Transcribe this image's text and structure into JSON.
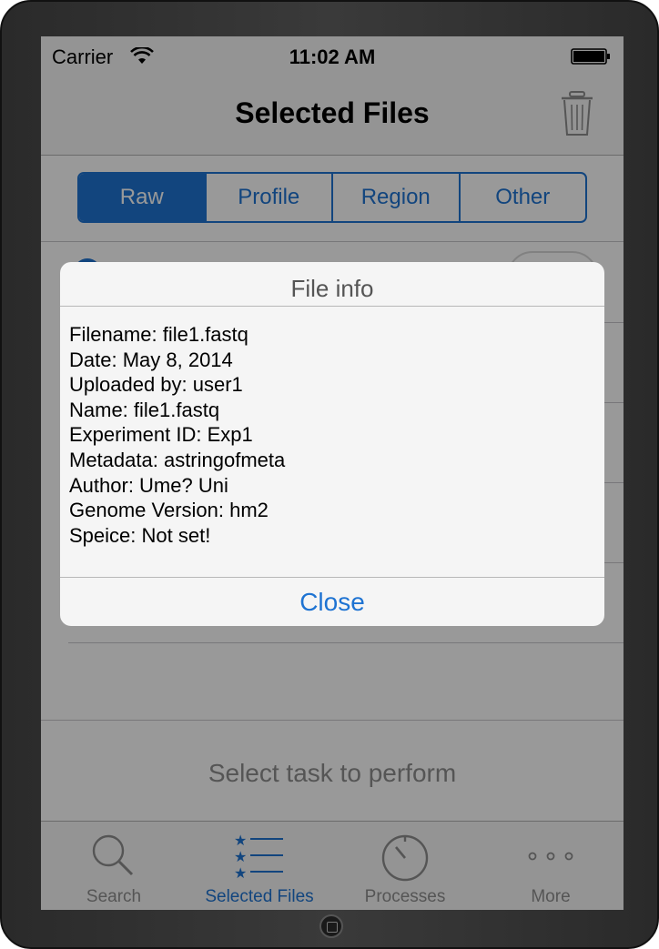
{
  "status_bar": {
    "carrier": "Carrier",
    "time": "11:02 AM"
  },
  "nav": {
    "title": "Selected Files"
  },
  "segments": [
    {
      "label": "Raw",
      "selected": true
    },
    {
      "label": "Profile",
      "selected": false
    },
    {
      "label": "Region",
      "selected": false
    },
    {
      "label": "Other",
      "selected": false
    }
  ],
  "task_label": "Select task to perform",
  "tabs": [
    {
      "label": "Search",
      "icon": "search-icon",
      "selected": false
    },
    {
      "label": "Selected Files",
      "icon": "starred-list-icon",
      "selected": true
    },
    {
      "label": "Processes",
      "icon": "stopwatch-icon",
      "selected": false
    },
    {
      "label": "More",
      "icon": "more-icon",
      "selected": false
    }
  ],
  "alert": {
    "title": "File info",
    "lines": [
      "Filename: file1.fastq",
      "Date: May 8, 2014",
      "Uploaded by: user1",
      "Name: file1.fastq",
      "Experiment ID: Exp1",
      "Metadata: astringofmeta",
      "Author: Ume? Uni",
      "Genome Version: hm2",
      "Speice: Not set!"
    ],
    "button": "Close"
  },
  "colors": {
    "accent": "#1e73d2",
    "dim_overlay": "rgba(0,0,0,0.40)"
  }
}
